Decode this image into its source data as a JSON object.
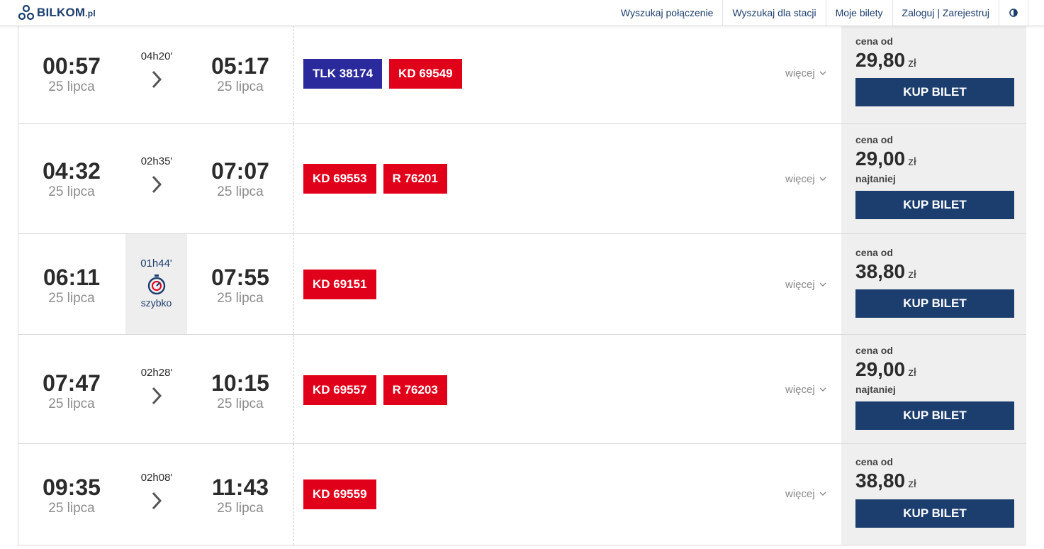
{
  "header": {
    "logo_text": "BILKOM",
    "logo_suffix": ".pl",
    "nav": [
      {
        "label": "Wyszukaj połączenie"
      },
      {
        "label": "Wyszukaj dla stacji"
      },
      {
        "label": "Moje bilety"
      },
      {
        "label": "Zaloguj | Zarejestruj"
      }
    ],
    "contrast_icon": "contrast-icon"
  },
  "labels": {
    "price_from": "cena od",
    "currency": "zł",
    "cheapest": "najtaniej",
    "buy": "KUP BILET",
    "more": "więcej",
    "fast": "szybko"
  },
  "connections": [
    {
      "dep_time": "00:57",
      "dep_date": "25 lipca",
      "duration": "04h20'",
      "arr_time": "05:17",
      "arr_date": "25 lipca",
      "trains": [
        {
          "label": "TLK 38174",
          "color": "#2a2a9c"
        },
        {
          "label": "KD 69549",
          "color": "#e1001a"
        }
      ],
      "price": "29,80",
      "cheapest": "",
      "fast": false
    },
    {
      "dep_time": "04:32",
      "dep_date": "25 lipca",
      "duration": "02h35'",
      "arr_time": "07:07",
      "arr_date": "25 lipca",
      "trains": [
        {
          "label": "KD 69553",
          "color": "#e1001a"
        },
        {
          "label": "R 76201",
          "color": "#e1001a"
        }
      ],
      "price": "29,00",
      "cheapest": "najtaniej",
      "fast": false
    },
    {
      "dep_time": "06:11",
      "dep_date": "25 lipca",
      "duration": "01h44'",
      "arr_time": "07:55",
      "arr_date": "25 lipca",
      "trains": [
        {
          "label": "KD 69151",
          "color": "#e1001a"
        }
      ],
      "price": "38,80",
      "cheapest": "",
      "fast": true
    },
    {
      "dep_time": "07:47",
      "dep_date": "25 lipca",
      "duration": "02h28'",
      "arr_time": "10:15",
      "arr_date": "25 lipca",
      "trains": [
        {
          "label": "KD 69557",
          "color": "#e1001a"
        },
        {
          "label": "R 76203",
          "color": "#e1001a"
        }
      ],
      "price": "29,00",
      "cheapest": "najtaniej",
      "fast": false
    },
    {
      "dep_time": "09:35",
      "dep_date": "25 lipca",
      "duration": "02h08'",
      "arr_time": "11:43",
      "arr_date": "25 lipca",
      "trains": [
        {
          "label": "KD 69559",
          "color": "#e1001a"
        }
      ],
      "price": "38,80",
      "cheapest": "",
      "fast": false
    }
  ]
}
